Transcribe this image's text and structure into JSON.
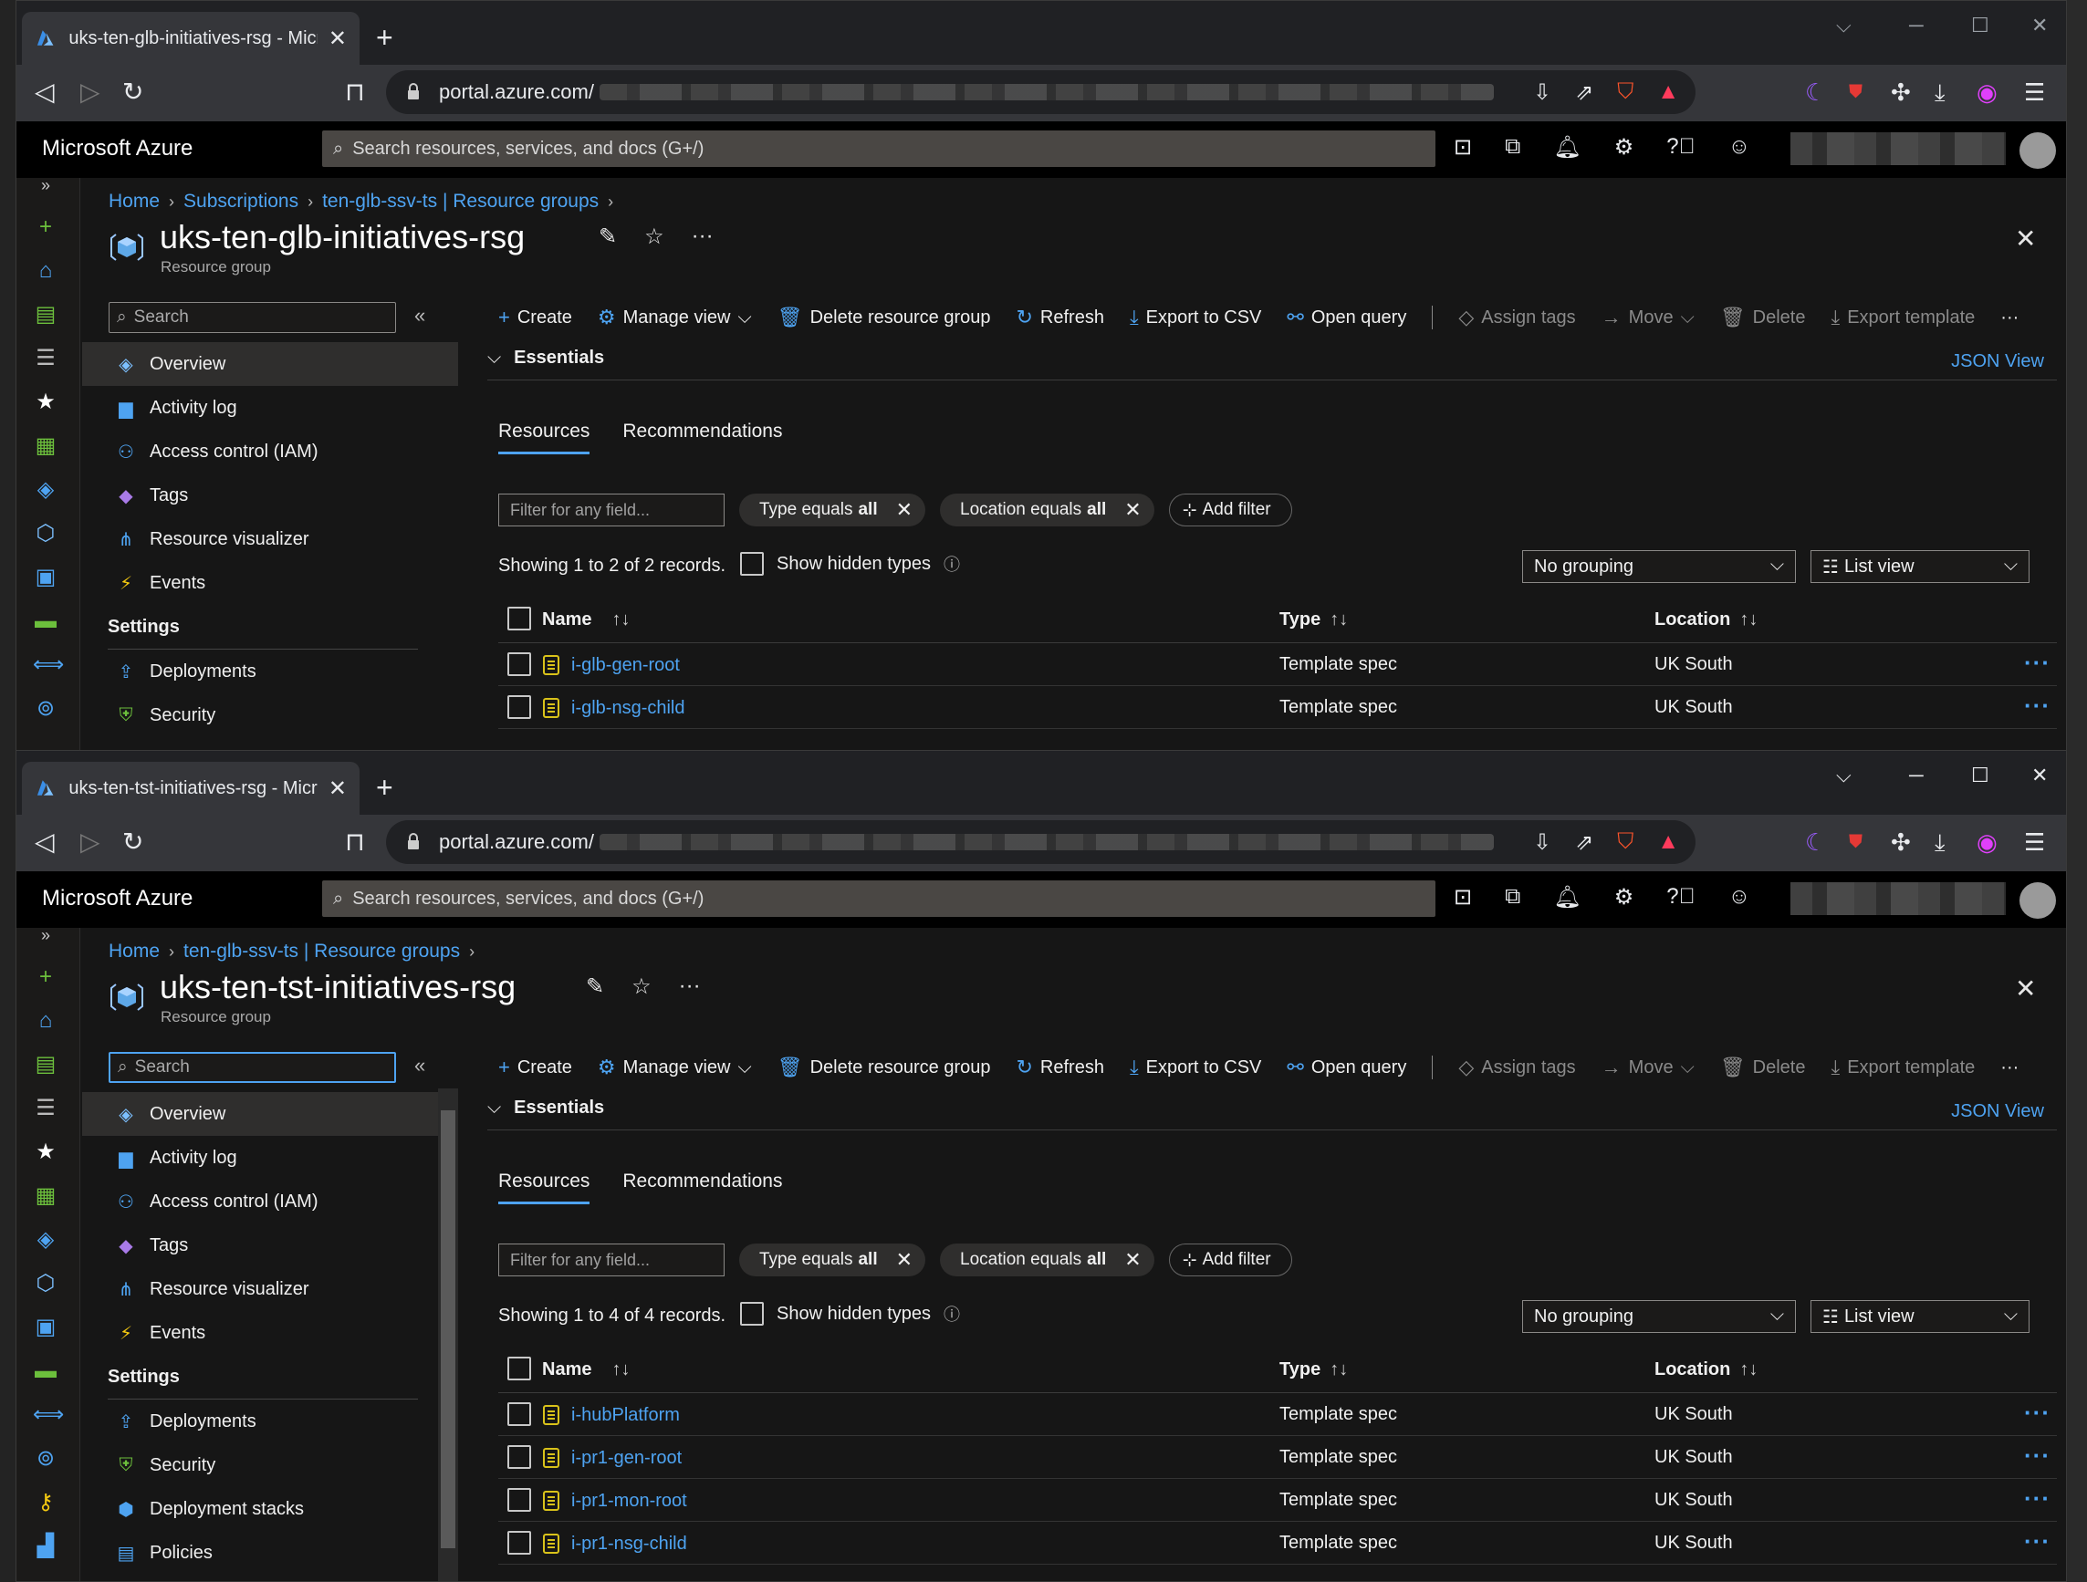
{
  "browser": {
    "url_visible": "portal.azure.com/",
    "window_controls": {
      "menu": "⌵",
      "minimize": "─",
      "maximize": "☐",
      "close": "✕"
    }
  },
  "azure": {
    "brand": "Microsoft Azure",
    "search_placeholder": "Search resources, services, and docs (G+/)"
  },
  "window1": {
    "tab_title": "uks-ten-glb-initiatives-rsg - Micro",
    "breadcrumb": [
      "Home",
      "Subscriptions",
      "ten-glb-ssv-ts | Resource groups"
    ],
    "title": "uks-ten-glb-initiatives-rsg",
    "subtitle": "Resource group",
    "left_search_placeholder": "Search",
    "menu": [
      {
        "label": "Overview",
        "icon": "overview-icon",
        "active": true
      },
      {
        "label": "Activity log",
        "icon": "activity-log-icon"
      },
      {
        "label": "Access control (IAM)",
        "icon": "iam-icon"
      },
      {
        "label": "Tags",
        "icon": "tag-icon"
      },
      {
        "label": "Resource visualizer",
        "icon": "visualizer-icon"
      },
      {
        "label": "Events",
        "icon": "lightning-icon"
      }
    ],
    "settings_heading": "Settings",
    "settings_menu": [
      {
        "label": "Deployments",
        "icon": "deployments-icon"
      },
      {
        "label": "Security",
        "icon": "shield-icon"
      }
    ],
    "records_text": "Showing 1 to 2 of 2 records.",
    "rows": [
      {
        "name": "i-glb-gen-root",
        "type": "Template spec",
        "location": "UK South"
      },
      {
        "name": "i-glb-nsg-child",
        "type": "Template spec",
        "location": "UK South"
      }
    ]
  },
  "window2": {
    "tab_title": "uks-ten-tst-initiatives-rsg - Micro",
    "breadcrumb": [
      "Home",
      "ten-glb-ssv-ts | Resource groups"
    ],
    "title": "uks-ten-tst-initiatives-rsg",
    "subtitle": "Resource group",
    "left_search_placeholder": "Search",
    "menu": [
      {
        "label": "Overview",
        "icon": "overview-icon",
        "active": true
      },
      {
        "label": "Activity log",
        "icon": "activity-log-icon"
      },
      {
        "label": "Access control (IAM)",
        "icon": "iam-icon"
      },
      {
        "label": "Tags",
        "icon": "tag-icon"
      },
      {
        "label": "Resource visualizer",
        "icon": "visualizer-icon"
      },
      {
        "label": "Events",
        "icon": "lightning-icon"
      }
    ],
    "settings_heading": "Settings",
    "settings_menu": [
      {
        "label": "Deployments",
        "icon": "deployments-icon"
      },
      {
        "label": "Security",
        "icon": "shield-icon"
      },
      {
        "label": "Deployment stacks",
        "icon": "stacks-icon"
      },
      {
        "label": "Policies",
        "icon": "policies-icon"
      }
    ],
    "records_text": "Showing 1 to 4 of 4 records.",
    "rows": [
      {
        "name": "i-hubPlatform",
        "type": "Template spec",
        "location": "UK South"
      },
      {
        "name": "i-pr1-gen-root",
        "type": "Template spec",
        "location": "UK South"
      },
      {
        "name": "i-pr1-mon-root",
        "type": "Template spec",
        "location": "UK South"
      },
      {
        "name": "i-pr1-nsg-child",
        "type": "Template spec",
        "location": "UK South"
      }
    ]
  },
  "toolbar": {
    "create": "Create",
    "manage_view": "Manage view",
    "delete_rg": "Delete resource group",
    "refresh": "Refresh",
    "export_csv": "Export to CSV",
    "open_query": "Open query",
    "assign_tags": "Assign tags",
    "move": "Move",
    "delete": "Delete",
    "export_template": "Export template"
  },
  "essentials": {
    "label": "Essentials",
    "json_view": "JSON View"
  },
  "subtabs": {
    "resources": "Resources",
    "recommendations": "Recommendations"
  },
  "filters": {
    "placeholder": "Filter for any field...",
    "type_pill_prefix": "Type equals",
    "location_pill_prefix": "Location equals",
    "pill_value": "all",
    "add_filter": "Add filter"
  },
  "options": {
    "show_hidden": "Show hidden types",
    "grouping": "No grouping",
    "view": "List view"
  },
  "columns": {
    "name": "Name",
    "type": "Type",
    "location": "Location"
  },
  "colors": {
    "accent": "#4ea3f1",
    "bg": "#161616",
    "header": "#000000"
  }
}
